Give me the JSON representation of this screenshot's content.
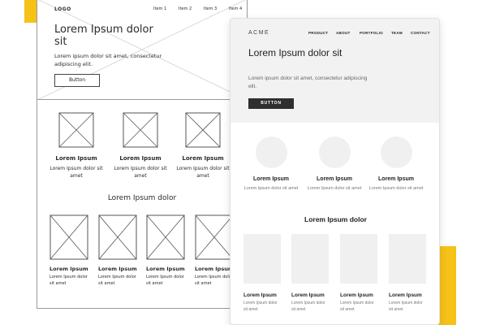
{
  "colors": {
    "accent": "#f5c218",
    "mock_hero_bg": "#f2f2f2",
    "mock_button_bg": "#2f2f2f",
    "placeholder": "#f0f0f0"
  },
  "sketch": {
    "logo": "LOGO",
    "nav": [
      "Item 1",
      "Item 2",
      "Item 3",
      "Item 4"
    ],
    "hero": {
      "title": "Lorem Ipsum dolor sit",
      "description": "Lorem ipsum dolor sit amet, consectetur adipiscing elit.",
      "button": "Button"
    },
    "features": [
      {
        "title": "Lorem Ipsum",
        "text": "Lorem Ipsum dolor sit amet",
        "icon": "image-placeholder-icon"
      },
      {
        "title": "Lorem Ipsum",
        "text": "Lorem Ipsum dolor sit amet",
        "icon": "image-placeholder-icon"
      },
      {
        "title": "Lorem Ipsum",
        "text": "Lorem Ipsum dolor sit amet",
        "icon": "image-placeholder-icon"
      }
    ],
    "section_title": "Lorem Ipsum dolor",
    "cards": [
      {
        "title": "Lorem Ipsum",
        "text": "Lorem Ipsum dolor sit amet"
      },
      {
        "title": "Lorem Ipsum",
        "text": "Lorem Ipsum dolor sit amet"
      },
      {
        "title": "Lorem Ipsum",
        "text": "Lorem Ipsum dolor sit amet"
      },
      {
        "title": "Lorem Ipsum",
        "text": "Lorem Ipsum dolor sit amet"
      }
    ]
  },
  "mockup": {
    "logo": "ACME",
    "nav": [
      "PRODUCT",
      "ABOUT",
      "PORTFOLIO",
      "TEAM",
      "CONTACT"
    ],
    "hero": {
      "title": "Lorem Ipsum dolor sit",
      "description": "Lorem ipsum dolor sit amet, consectetur adipiscing elit.",
      "button": "BUTTON"
    },
    "features": [
      {
        "title": "Lorem Ipsum",
        "text": "Lorem Ipsum dolor sit amet"
      },
      {
        "title": "Lorem Ipsum",
        "text": "Lorem Ipsum dolor sit amet"
      },
      {
        "title": "Lorem Ipsum",
        "text": "Lorem Ipsum dolor sit amet"
      }
    ],
    "section_title": "Lorem Ipsum dolor",
    "cards": [
      {
        "title": "Lorem Ipsum",
        "text": "Lorem Ipsum dolor sit amet"
      },
      {
        "title": "Lorem Ipsum",
        "text": "Lorem Ipsum dolor sit amet"
      },
      {
        "title": "Lorem Ipsum",
        "text": "Lorem Ipsum dolor sit amet"
      },
      {
        "title": "Lorem Ipsum",
        "text": "Lorem Ipsum dolor sit amet"
      }
    ]
  }
}
